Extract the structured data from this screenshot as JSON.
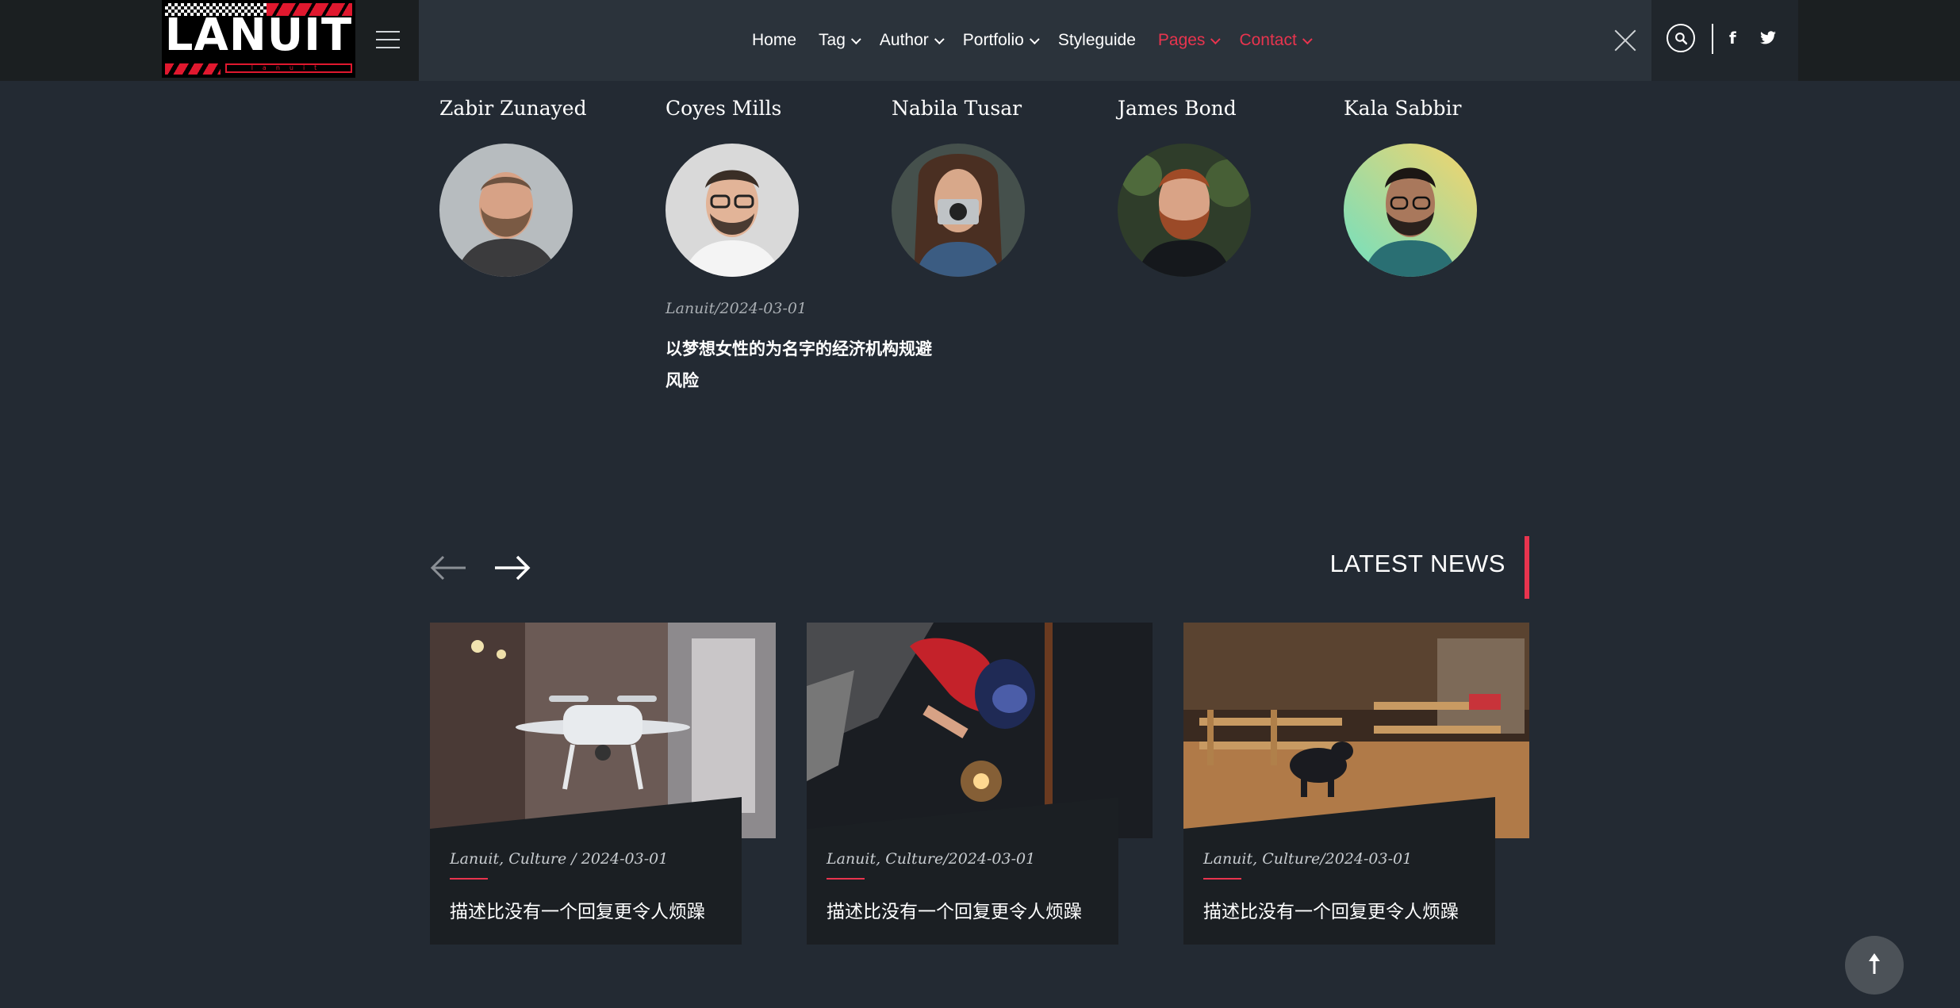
{
  "header": {
    "logo_text": "LANUIT",
    "logo_sub": "lanuit",
    "nav": [
      {
        "label": "Home",
        "dropdown": false,
        "accent": false
      },
      {
        "label": "Tag",
        "dropdown": true,
        "accent": false
      },
      {
        "label": "Author",
        "dropdown": true,
        "accent": false
      },
      {
        "label": "Portfolio",
        "dropdown": true,
        "accent": false
      },
      {
        "label": "Styleguide",
        "dropdown": false,
        "accent": false
      },
      {
        "label": "Pages",
        "dropdown": true,
        "accent": true
      },
      {
        "label": "Contact",
        "dropdown": true,
        "accent": true
      }
    ],
    "social": {
      "facebook": "f",
      "twitter": "twitter-icon"
    }
  },
  "authors": [
    {
      "name": "Zabir Zunayed"
    },
    {
      "name": "Coyes Mills"
    },
    {
      "name": "Nabila Tusar"
    },
    {
      "name": "James Bond"
    },
    {
      "name": "Kala Sabbir"
    }
  ],
  "featured_post": {
    "meta": "Lanuit/2024-03-01",
    "title": "以梦想女性的为名字的经济机构规避风险"
  },
  "latest_news": {
    "heading": "LATEST NEWS",
    "cards": [
      {
        "meta": "Lanuit, Culture / 2024-03-01",
        "title": "描述比没有一个回复更令人烦躁"
      },
      {
        "meta": "Lanuit, Culture/2024-03-01",
        "title": "描述比没有一个回复更令人烦躁"
      },
      {
        "meta": "Lanuit, Culture/2024-03-01",
        "title": "描述比没有一个回复更令人烦躁"
      }
    ]
  },
  "colors": {
    "accent": "#e8344e",
    "background": "#232a33",
    "nav_panel": "#2b333b"
  }
}
